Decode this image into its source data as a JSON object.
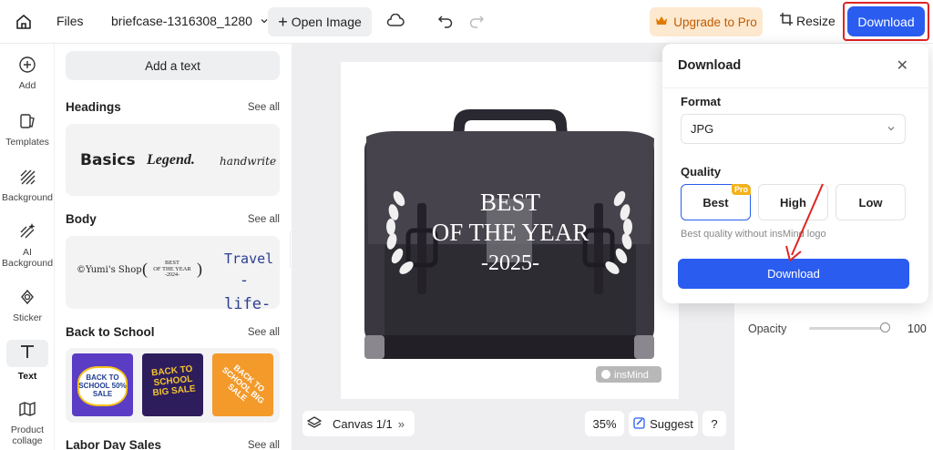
{
  "topbar": {
    "files": "Files",
    "filename": "briefcase-1316308_1280",
    "open_image": "Open Image",
    "upgrade": "Upgrade to Pro",
    "resize": "Resize",
    "download": "Download"
  },
  "nav": [
    {
      "label": "Add",
      "icon": "plus-circle-icon"
    },
    {
      "label": "Templates",
      "icon": "templates-icon"
    },
    {
      "label": "Background",
      "icon": "background-icon"
    },
    {
      "label": "AI Background",
      "icon": "ai-background-icon"
    },
    {
      "label": "Sticker",
      "icon": "sticker-icon"
    },
    {
      "label": "Text",
      "icon": "text-icon"
    },
    {
      "label": "Product collage",
      "icon": "collage-icon"
    }
  ],
  "panel": {
    "add_text": "Add a text",
    "see_all": "See all",
    "headings": {
      "title": "Headings",
      "samples": [
        "Basics",
        "Legend.",
        "handwrite"
      ]
    },
    "body": {
      "title": "Body",
      "samples": [
        "©Yumi's Shop",
        "BEST",
        "OF THE YEAR",
        "-2024-",
        "Travel",
        "-life-"
      ]
    },
    "back_to_school": {
      "title": "Back to School",
      "samples": [
        "BACK TO SCHOOL 50% SALE",
        "BACK TO SCHOOL BIG SALE",
        "BACK TO SCHOOL BIG SALE"
      ]
    },
    "labor_day": {
      "title": "Labor Day Sales"
    }
  },
  "canvas": {
    "overlay_line1": "BEST",
    "overlay_line2": "OF THE YEAR",
    "overlay_line3": "-2025-",
    "watermark": "insMind",
    "canvas_label": "Canvas 1/1",
    "zoom": "35%",
    "suggest": "Suggest",
    "help": "?"
  },
  "right": {
    "opacity_label": "Opacity",
    "opacity_value": "100"
  },
  "download_popup": {
    "title": "Download",
    "format_label": "Format",
    "format_value": "JPG",
    "quality_label": "Quality",
    "quality_options": [
      "Best",
      "High",
      "Low"
    ],
    "selected_quality": "Best",
    "pro_badge": "Pro",
    "quality_note": "Best quality without insMind logo",
    "download_button": "Download"
  },
  "colors": {
    "accent": "#2a5cf0",
    "upgrade_bg": "#fde9cf",
    "upgrade_text": "#c25b00",
    "highlight": "#e02424"
  }
}
